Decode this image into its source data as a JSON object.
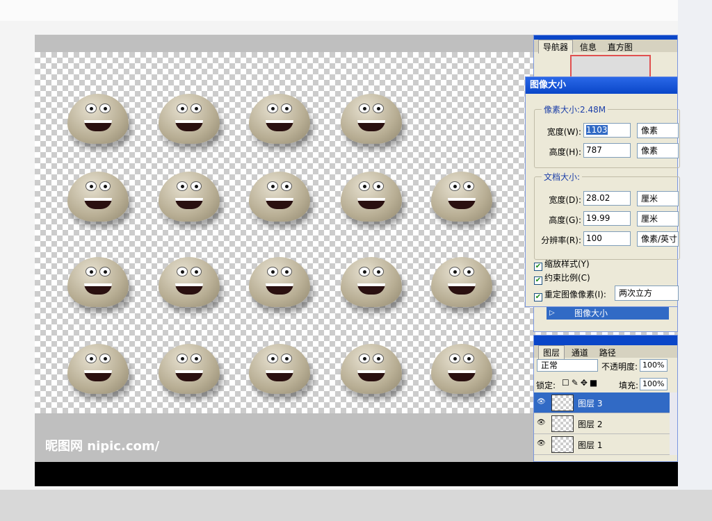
{
  "watermark": "昵图网 nipic.com/",
  "navigator": {
    "tabs": [
      "导航器",
      "信息",
      "直方图"
    ]
  },
  "image_size_dialog": {
    "title": "图像大小",
    "pixel_group": "像素大小:2.48M",
    "width_label": "宽度(W):",
    "width_value": "1103",
    "width_unit": "像素",
    "height_label": "高度(H):",
    "height_value": "787",
    "height_unit": "像素",
    "doc_group": "文档大小:",
    "doc_width_label": "宽度(D):",
    "doc_width_value": "28.02",
    "doc_width_unit": "厘米",
    "doc_height_label": "高度(G):",
    "doc_height_value": "19.99",
    "doc_height_unit": "厘米",
    "res_label": "分辨率(R):",
    "res_value": "100",
    "res_unit": "像素/英寸",
    "scale_styles": "缩放样式(Y)",
    "constrain": "约束比例(C)",
    "resample": "重定图像像素(I):",
    "resample_method": "两次立方"
  },
  "history": {
    "item": "图像大小"
  },
  "layers_panel": {
    "tabs": [
      "图层",
      "通道",
      "路径"
    ],
    "blend_mode": "正常",
    "opacity_label": "不透明度:",
    "opacity": "100%",
    "lock_label": "锁定:",
    "fill_label": "填充:",
    "fill": "100%",
    "layers": [
      "图层 3",
      "图层 2",
      "图层 1"
    ]
  },
  "colors": {
    "titlebar": "#0a46c8",
    "panel": "#ece9d8",
    "selected": "#316ac5"
  }
}
